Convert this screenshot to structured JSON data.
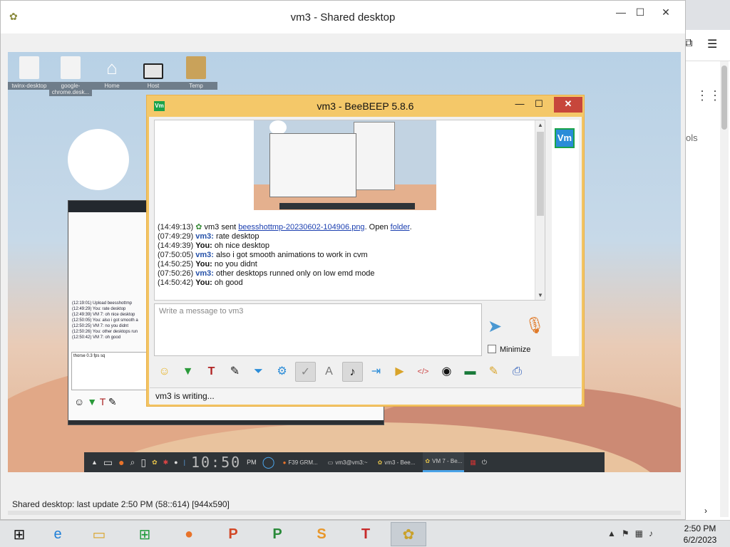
{
  "outer_window": {
    "title": "vm3 - Shared desktop",
    "status": "Shared desktop: last update 2:50 PM (58::614) [944x590]",
    "controls": {
      "minimize": "—",
      "maximize": "☐",
      "close": "✕"
    }
  },
  "background_browser": {
    "partial_text": "ols"
  },
  "remote_desktop": {
    "icons": [
      {
        "label": "twinx-desktop"
      },
      {
        "label": "google-chrome.desk..."
      },
      {
        "label": "Home"
      },
      {
        "label": "Host"
      },
      {
        "label": "Temp"
      }
    ],
    "small_window": {
      "chat_lines": [
        "(12:19:01) Upload beesshottmp",
        "(12:49:29) You: rate desktop",
        "(12:49:39) VM 7: oh nice desktop",
        "(12:50:05) You: also i got smooth a",
        "(12:50:25) VM 7: no you didnt",
        "(12:50:26) You: other desktops run",
        "(12:50:42) VM 7: oh good"
      ],
      "input_text": "thorse 0.3 fps sq"
    },
    "dock": {
      "clock": "10:50",
      "clock_suffix": "PM",
      "tasks": [
        {
          "label": "F39 GRM..."
        },
        {
          "label": "vm3@vm3:~"
        },
        {
          "label": "vm3 - Bee..."
        },
        {
          "label": "VM 7 - Be...",
          "active": true
        }
      ]
    }
  },
  "chat_window": {
    "title": "vm3 - BeeBEEP 5.8.6",
    "title_icon": "Vm",
    "controls": {
      "minimize": "—",
      "maximize": "☐",
      "close": "✕"
    },
    "messages": [
      {
        "time": "(14:49:13)",
        "who": "",
        "pre": " vm3 sent ",
        "link": "beesshottmp-20230602-104906.png",
        "mid": ". Open ",
        "link2": "folder",
        "post": "."
      },
      {
        "time": "(07:49:29)",
        "who": "vm3:",
        "text": " rate desktop"
      },
      {
        "time": "(14:49:39)",
        "who": "You:",
        "text": " oh nice desktop"
      },
      {
        "time": "(07:50:05)",
        "who": "vm3:",
        "text": " also i got smooth animations to work in cvm"
      },
      {
        "time": "(14:50:25)",
        "who": "You:",
        "text": " no you didnt"
      },
      {
        "time": "(07:50:26)",
        "who": "vm3:",
        "text": " other desktops runned only on low emd mode"
      },
      {
        "time": "(14:50:42)",
        "who": "You:",
        "text": " oh good"
      }
    ],
    "input_placeholder": "Write a message to vm3",
    "minimize_label": "Minimize",
    "status": "vm3 is writing...",
    "user_avatar": "Vm",
    "toolbar_icons": [
      "emoji-icon",
      "arrow-down-icon",
      "text-format-icon",
      "pen-icon",
      "filter-icon",
      "gears-icon",
      "spellcheck-icon",
      "font-icon",
      "music-note-icon",
      "file-send-icon",
      "folder-send-icon",
      "code-icon",
      "camera-icon",
      "screen-share-icon",
      "notes-icon",
      "save-icon"
    ]
  },
  "taskbar": {
    "apps": [
      "windows-start-icon",
      "internet-explorer-icon",
      "file-explorer-icon",
      "store-icon",
      "firefox-icon",
      "powerpoint-icon",
      "publisher-icon",
      "sway-icon",
      "t-app-icon",
      "beebeep-icon"
    ],
    "time": "2:50 PM",
    "date": "6/2/2023"
  }
}
